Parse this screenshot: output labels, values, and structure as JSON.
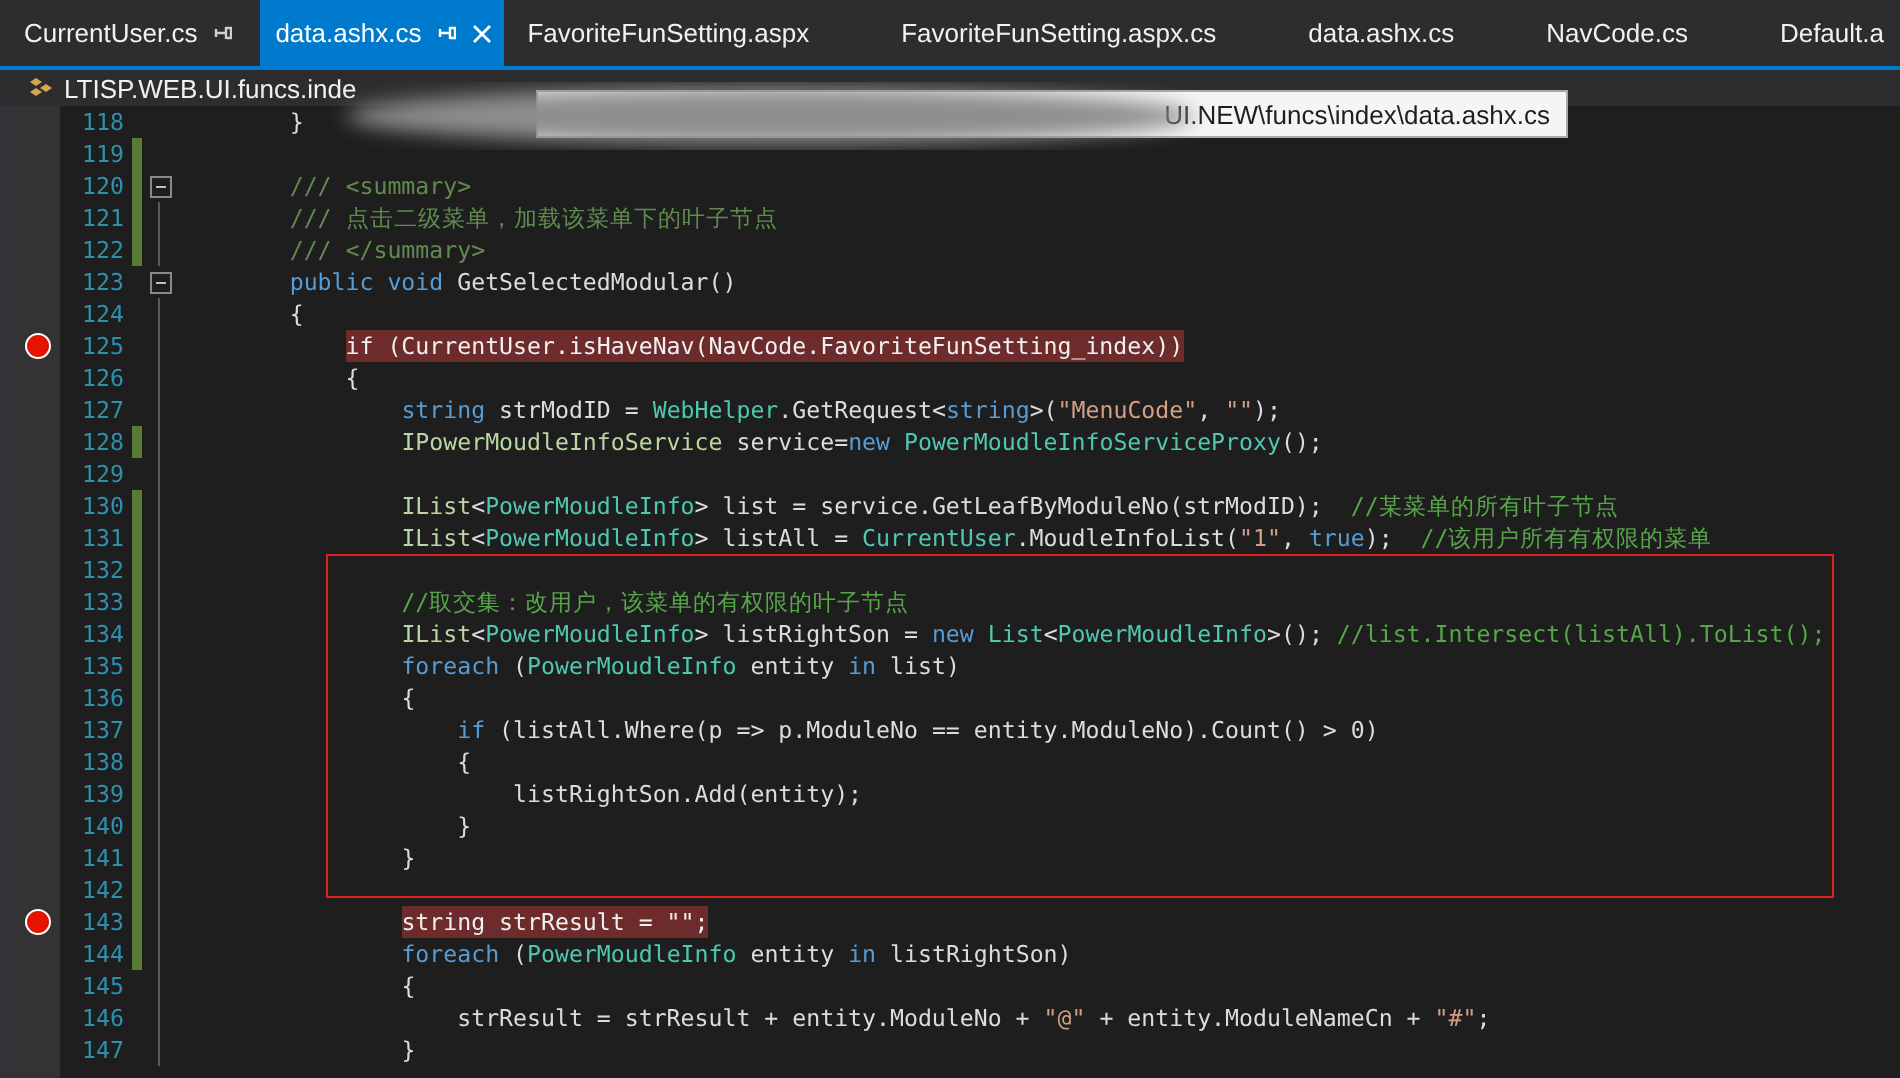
{
  "tabs": [
    {
      "label": "CurrentUser.cs",
      "selected": false,
      "pinned": true
    },
    {
      "label": "data.ashx.cs",
      "selected": true,
      "pinned": true
    },
    {
      "label": "FavoriteFunSetting.aspx",
      "selected": false,
      "pinned": false
    },
    {
      "label": "FavoriteFunSetting.aspx.cs",
      "selected": false,
      "pinned": false
    },
    {
      "label": "data.ashx.cs",
      "selected": false,
      "pinned": false
    },
    {
      "label": "NavCode.cs",
      "selected": false,
      "pinned": false
    },
    {
      "label": "Default.a",
      "selected": false,
      "pinned": false
    }
  ],
  "navigation_bar": {
    "scope": "LTISP.WEB.UI.funcs.inde"
  },
  "tooltip": {
    "text": "UI.NEW\\funcs\\index\\data.ashx.cs"
  },
  "code_lines": [
    {
      "number": "118",
      "breakpoint": false,
      "changed": false,
      "fold": false,
      "tokens": [
        {
          "kind": "plain",
          "text": "        }"
        }
      ]
    },
    {
      "number": "119",
      "breakpoint": false,
      "changed": true,
      "fold": false
    },
    {
      "number": "120",
      "breakpoint": false,
      "changed": true,
      "fold": true,
      "tokens": [
        {
          "kind": "doc",
          "text": "        /// <summary>"
        }
      ]
    },
    {
      "number": "121",
      "breakpoint": false,
      "changed": true,
      "fold": false,
      "tokens": [
        {
          "kind": "doc",
          "text": "        /// 点击二级菜单，加载该菜单下的叶子节点"
        }
      ]
    },
    {
      "number": "122",
      "breakpoint": false,
      "changed": true,
      "fold": false,
      "tokens": [
        {
          "kind": "doc",
          "text": "        /// </summary>"
        }
      ]
    },
    {
      "number": "123",
      "breakpoint": false,
      "changed": false,
      "fold": true,
      "tokens": [
        {
          "kind": "keyword",
          "text": "        public void"
        },
        {
          "kind": "plain",
          "text": " GetSelectedModular()"
        }
      ]
    },
    {
      "number": "124",
      "breakpoint": false,
      "changed": false,
      "fold": false,
      "tokens": [
        {
          "kind": "plain",
          "text": "        {"
        }
      ]
    },
    {
      "number": "125",
      "breakpoint": true,
      "changed": false,
      "fold": false,
      "tokens": [
        {
          "text": "            if (CurrentUser.isHaveNav(NavCode.FavoriteFunSetting_index))"
        }
      ]
    },
    {
      "number": "126",
      "breakpoint": false,
      "changed": false,
      "fold": false,
      "tokens": [
        {
          "kind": "plain",
          "text": "            {"
        }
      ]
    },
    {
      "number": "127",
      "breakpoint": false,
      "changed": false,
      "fold": false,
      "tokens": [
        {
          "kind": "keyword",
          "text": "                string"
        },
        {
          "kind": "plain",
          "text": " strModID = "
        },
        {
          "kind": "type",
          "text": "WebHelper"
        },
        {
          "kind": "plain",
          "text": ".GetRequest<"
        },
        {
          "kind": "keyword",
          "text": "string"
        },
        {
          "kind": "plain",
          "text": ">("
        },
        {
          "kind": "string",
          "text": "\"MenuCode\""
        },
        {
          "kind": "plain",
          "text": ", "
        },
        {
          "kind": "string",
          "text": "\"\""
        },
        {
          "kind": "plain",
          "text": ");"
        }
      ]
    },
    {
      "number": "128",
      "breakpoint": false,
      "changed": true,
      "fold": false,
      "tokens": [
        {
          "kind": "interface",
          "text": "                IPowerMoudleInfoService"
        },
        {
          "kind": "plain",
          "text": " service="
        },
        {
          "kind": "keyword",
          "text": "new"
        },
        {
          "kind": "type",
          "text": " PowerMoudleInfoServiceProxy"
        },
        {
          "kind": "plain",
          "text": "();"
        }
      ]
    },
    {
      "number": "129",
      "breakpoint": false,
      "changed": false,
      "fold": false
    },
    {
      "number": "130",
      "breakpoint": false,
      "changed": true,
      "fold": false,
      "tokens": [
        {
          "kind": "interface",
          "text": "                IList"
        },
        {
          "kind": "plain",
          "text": "<"
        },
        {
          "kind": "type",
          "text": "PowerMoudleInfo"
        },
        {
          "kind": "plain",
          "text": "> list = service.GetLeafByModuleNo(strModID);  "
        },
        {
          "kind": "comment",
          "text": "//某菜单的所有叶子节点"
        }
      ]
    },
    {
      "number": "131",
      "breakpoint": false,
      "changed": true,
      "fold": false,
      "tokens": [
        {
          "kind": "interface",
          "text": "                IList"
        },
        {
          "kind": "plain",
          "text": "<"
        },
        {
          "kind": "type",
          "text": "PowerMoudleInfo"
        },
        {
          "kind": "plain",
          "text": "> listAll = "
        },
        {
          "kind": "type",
          "text": "CurrentUser"
        },
        {
          "kind": "plain",
          "text": ".MoudleInfoList("
        },
        {
          "kind": "string",
          "text": "\"1\""
        },
        {
          "kind": "plain",
          "text": ", "
        },
        {
          "kind": "keyword",
          "text": "true"
        },
        {
          "kind": "plain",
          "text": ");  "
        },
        {
          "kind": "comment",
          "text": "//该用户所有有权限的菜单"
        }
      ]
    },
    {
      "number": "132",
      "breakpoint": false,
      "changed": true,
      "fold": false
    },
    {
      "number": "133",
      "breakpoint": false,
      "changed": true,
      "fold": false,
      "tokens": [
        {
          "kind": "comment",
          "text": "                //取交集：改用户，该菜单的有权限的叶子节点"
        }
      ]
    },
    {
      "number": "134",
      "breakpoint": false,
      "changed": true,
      "fold": false,
      "tokens": [
        {
          "kind": "interface",
          "text": "                IList"
        },
        {
          "kind": "plain",
          "text": "<"
        },
        {
          "kind": "type",
          "text": "PowerMoudleInfo"
        },
        {
          "kind": "plain",
          "text": "> listRightSon = "
        },
        {
          "kind": "keyword",
          "text": "new"
        },
        {
          "kind": "type",
          "text": " List"
        },
        {
          "kind": "plain",
          "text": "<"
        },
        {
          "kind": "type",
          "text": "PowerMoudleInfo"
        },
        {
          "kind": "plain",
          "text": ">(); "
        },
        {
          "kind": "comment",
          "text": "//list.Intersect(listAll).ToList();"
        }
      ]
    },
    {
      "number": "135",
      "breakpoint": false,
      "changed": true,
      "fold": false,
      "tokens": [
        {
          "kind": "keyword",
          "text": "                foreach"
        },
        {
          "kind": "plain",
          "text": " ("
        },
        {
          "kind": "type",
          "text": "PowerMoudleInfo"
        },
        {
          "kind": "plain",
          "text": " entity "
        },
        {
          "kind": "keyword",
          "text": "in"
        },
        {
          "kind": "plain",
          "text": " list)"
        }
      ]
    },
    {
      "number": "136",
      "breakpoint": false,
      "changed": true,
      "fold": false,
      "tokens": [
        {
          "kind": "plain",
          "text": "                {"
        }
      ]
    },
    {
      "number": "137",
      "breakpoint": false,
      "changed": true,
      "fold": false,
      "tokens": [
        {
          "kind": "keyword",
          "text": "                    if"
        },
        {
          "kind": "plain",
          "text": " (listAll.Where(p => p.ModuleNo == entity.ModuleNo).Count() > 0)"
        }
      ]
    },
    {
      "number": "138",
      "breakpoint": false,
      "changed": true,
      "fold": false,
      "tokens": [
        {
          "kind": "plain",
          "text": "                    {"
        }
      ]
    },
    {
      "number": "139",
      "breakpoint": false,
      "changed": true,
      "fold": false,
      "tokens": [
        {
          "kind": "plain",
          "text": "                        listRightSon.Add(entity);"
        }
      ]
    },
    {
      "number": "140",
      "breakpoint": false,
      "changed": true,
      "fold": false,
      "tokens": [
        {
          "kind": "plain",
          "text": "                    }"
        }
      ]
    },
    {
      "number": "141",
      "breakpoint": false,
      "changed": true,
      "fold": false,
      "tokens": [
        {
          "kind": "plain",
          "text": "                }"
        }
      ]
    },
    {
      "number": "142",
      "breakpoint": false,
      "changed": true,
      "fold": false
    },
    {
      "number": "143",
      "breakpoint": true,
      "changed": true,
      "fold": false,
      "tokens": [
        {
          "text": "                string strResult = \"\";"
        }
      ]
    },
    {
      "number": "144",
      "breakpoint": false,
      "changed": true,
      "fold": false,
      "tokens": [
        {
          "kind": "keyword",
          "text": "                foreach"
        },
        {
          "kind": "plain",
          "text": " ("
        },
        {
          "kind": "type",
          "text": "PowerMoudleInfo"
        },
        {
          "kind": "plain",
          "text": " entity "
        },
        {
          "kind": "keyword",
          "text": "in"
        },
        {
          "kind": "plain",
          "text": " listRightSon)"
        }
      ]
    },
    {
      "number": "145",
      "breakpoint": false,
      "changed": false,
      "fold": false,
      "tokens": [
        {
          "kind": "plain",
          "text": "                {"
        }
      ]
    },
    {
      "number": "146",
      "breakpoint": false,
      "changed": false,
      "fold": false,
      "tokens": [
        {
          "kind": "plain",
          "text": "                    strResult = strResult + entity.ModuleNo + "
        },
        {
          "kind": "string",
          "text": "\"@\""
        },
        {
          "kind": "plain",
          "text": " + entity.ModuleNameCn + "
        },
        {
          "kind": "string",
          "text": "\"#\""
        },
        {
          "kind": "plain",
          "text": ";"
        }
      ]
    },
    {
      "number": "147",
      "breakpoint": false,
      "changed": false,
      "fold": false,
      "tokens": [
        {
          "kind": "plain",
          "text": "                }"
        }
      ]
    }
  ]
}
